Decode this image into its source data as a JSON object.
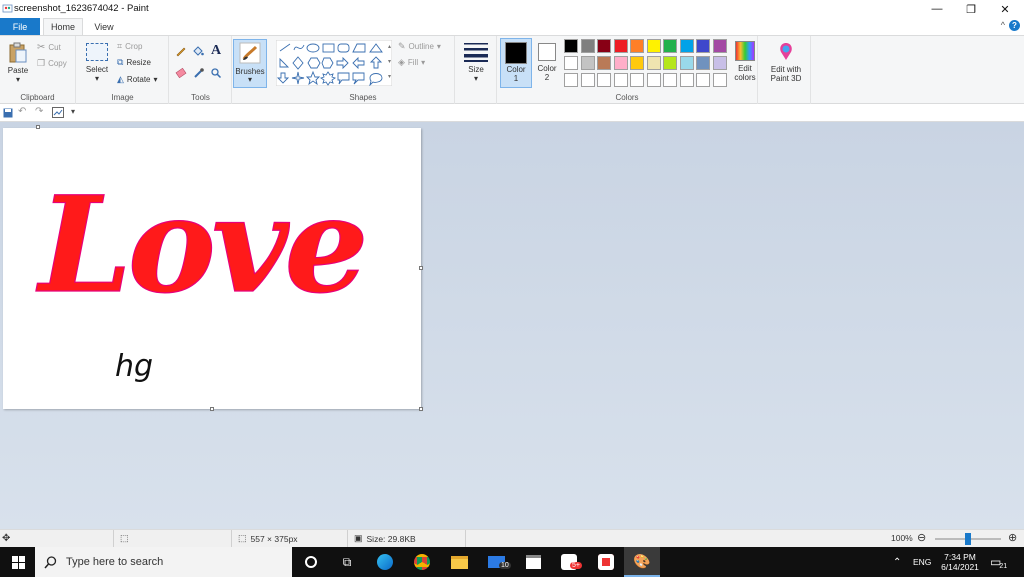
{
  "window": {
    "title": "screenshot_1623674042 - Paint",
    "minimize": "—",
    "restore": "❐",
    "close": "✕"
  },
  "tabs": {
    "file": "File",
    "home": "Home",
    "view": "View",
    "help_icon": "?",
    "collapse_icon": "^"
  },
  "ribbon": {
    "clipboard": {
      "label": "Clipboard",
      "paste": "Paste",
      "cut": "Cut",
      "copy": "Copy"
    },
    "image": {
      "label": "Image",
      "select": "Select",
      "crop": "Crop",
      "resize": "Resize",
      "rotate": "Rotate"
    },
    "tools": {
      "label": "Tools",
      "brushes": "Brushes"
    },
    "shapes": {
      "label": "Shapes",
      "outline": "Outline",
      "fill": "Fill"
    },
    "size": {
      "label": "Size"
    },
    "colors": {
      "label": "Colors",
      "color1": "Color\n1",
      "color1_a": "Color",
      "color1_b": "1",
      "color2_a": "Color",
      "color2_b": "2",
      "color1_value": "#000000",
      "color2_value": "#ffffff",
      "edit_colors_a": "Edit",
      "edit_colors_b": "colors",
      "palette_row1": [
        "#000000",
        "#7f7f7f",
        "#880015",
        "#ed1c24",
        "#ff7f27",
        "#fff200",
        "#22b14c",
        "#00a2e8",
        "#3f48cc",
        "#a349a4"
      ],
      "palette_row2": [
        "#ffffff",
        "#c3c3c3",
        "#b97a57",
        "#ffaec9",
        "#ffc90e",
        "#efe4b0",
        "#b5e61d",
        "#99d9ea",
        "#7092be",
        "#c8bfe7"
      ],
      "palette_row3": [
        "#ffffff",
        "#ffffff",
        "#ffffff",
        "#ffffff",
        "#ffffff",
        "#ffffff",
        "#ffffff",
        "#ffffff",
        "#ffffff",
        "#ffffff"
      ]
    },
    "paint3d": {
      "a": "Edit with",
      "b": "Paint 3D"
    }
  },
  "canvas": {
    "word": "Love",
    "scribble": "hg",
    "word_color": "#ff1a1a"
  },
  "status": {
    "dimensions": "557 × 375px",
    "size": "Size: 29.8KB",
    "zoom": "100%",
    "zoom_fraction": 0.5
  },
  "taskbar": {
    "search_placeholder": "Type here to search",
    "mail_badge": "10",
    "app_badge": "5+",
    "lang": "ENG",
    "time": "7:34 PM",
    "date": "6/14/2021",
    "notifications": "21"
  }
}
